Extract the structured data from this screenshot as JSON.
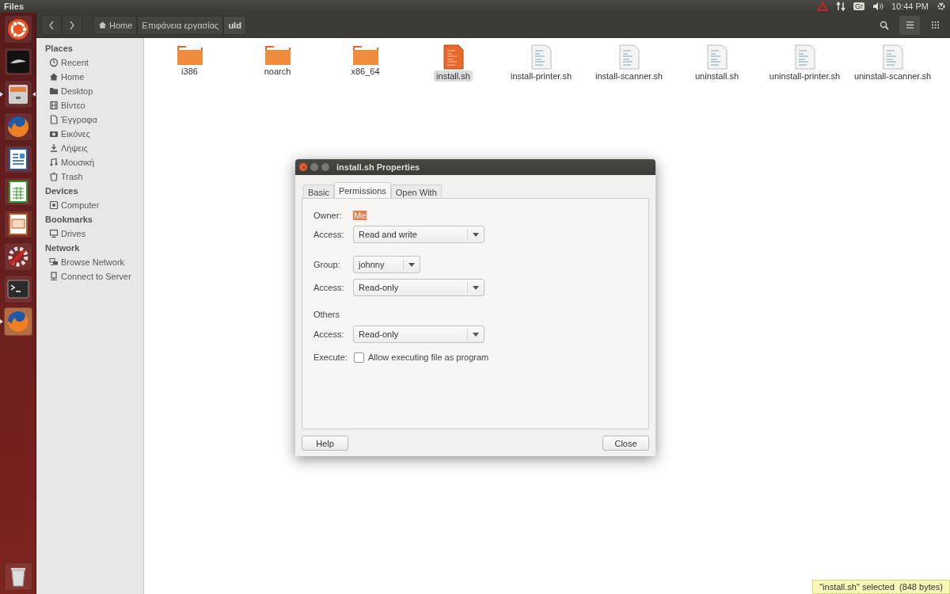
{
  "top_panel": {
    "app_title": "Files",
    "keyboard_layout": "Gr",
    "clock": "10:44 PM"
  },
  "launcher": {
    "items": [
      {
        "kind": "ubuntu",
        "running": false,
        "focused": false
      },
      {
        "kind": "dark-app",
        "running": false,
        "focused": false
      },
      {
        "kind": "files",
        "running": true,
        "focused": true
      },
      {
        "kind": "firefox",
        "running": false,
        "focused": false
      },
      {
        "kind": "writer",
        "running": false,
        "focused": false
      },
      {
        "kind": "calc",
        "running": false,
        "focused": false
      },
      {
        "kind": "impress",
        "running": false,
        "focused": false
      },
      {
        "kind": "settings",
        "running": false,
        "focused": false
      },
      {
        "kind": "terminal",
        "running": false,
        "focused": false
      },
      {
        "kind": "firefox",
        "running": true,
        "focused": false
      }
    ]
  },
  "toolbar": {
    "breadcrumbs": [
      {
        "label": "Home",
        "kind": "home",
        "selected": false
      },
      {
        "label": "Επιφάνεια εργασίας",
        "kind": "plain",
        "selected": false
      },
      {
        "label": "uld",
        "kind": "plain",
        "selected": true
      }
    ],
    "view_buttons": [
      {
        "kind": "search",
        "selected": false
      },
      {
        "kind": "list",
        "selected": true
      },
      {
        "kind": "grid",
        "selected": false
      }
    ]
  },
  "sidebar": {
    "sections": [
      {
        "title": "Places",
        "items": [
          {
            "label": "Recent"
          },
          {
            "label": "Home"
          },
          {
            "label": "Desktop"
          },
          {
            "label": "Βίντεο"
          },
          {
            "label": "Έγγραφα"
          },
          {
            "label": "Εικόνες"
          },
          {
            "label": "Λήψεις"
          },
          {
            "label": "Μουσική"
          },
          {
            "label": "Trash"
          }
        ]
      },
      {
        "title": "Devices",
        "items": [
          {
            "label": "Computer"
          }
        ]
      },
      {
        "title": "Bookmarks",
        "items": [
          {
            "label": "Drives"
          }
        ]
      },
      {
        "title": "Network",
        "items": [
          {
            "label": "Browse Network"
          },
          {
            "label": "Connect to Server"
          }
        ]
      }
    ]
  },
  "files": [
    {
      "name": "i386",
      "kind": "folder",
      "selected": false
    },
    {
      "name": "noarch",
      "kind": "folder",
      "selected": false
    },
    {
      "name": "x86_64",
      "kind": "folder",
      "selected": false
    },
    {
      "name": "install.sh",
      "kind": "script",
      "selected": true
    },
    {
      "name": "install-printer.sh",
      "kind": "script",
      "selected": false
    },
    {
      "name": "install-scanner.sh",
      "kind": "script",
      "selected": false
    },
    {
      "name": "uninstall.sh",
      "kind": "script",
      "selected": false
    },
    {
      "name": "uninstall-printer.sh",
      "kind": "script",
      "selected": false
    },
    {
      "name": "uninstall-scanner.sh",
      "kind": "script",
      "selected": false
    }
  ],
  "status_bar": {
    "text": "\"install.sh\" selected  (848 bytes)"
  },
  "dialog": {
    "title": "install.sh Properties",
    "tabs": [
      {
        "label": "Basic",
        "selected": false
      },
      {
        "label": "Permissions",
        "selected": true
      },
      {
        "label": "Open With",
        "selected": false
      }
    ],
    "rows": [
      {
        "kind": "text",
        "label": "Owner:",
        "value": "Me",
        "selected": true
      },
      {
        "kind": "combo",
        "label": "Access:",
        "value": "Read and write"
      },
      {
        "kind": "gap"
      },
      {
        "kind": "small-combo",
        "label": "Group:",
        "value": "johnny"
      },
      {
        "kind": "combo",
        "label": "Access:",
        "value": "Read-only"
      },
      {
        "kind": "gap"
      },
      {
        "kind": "heading",
        "label": "Others"
      },
      {
        "kind": "combo",
        "label": "Access:",
        "value": "Read-only"
      },
      {
        "kind": "check",
        "label": "Execute:",
        "value": "Allow executing file as program",
        "checked": false
      }
    ],
    "buttons": [
      "Help",
      "Close"
    ]
  }
}
